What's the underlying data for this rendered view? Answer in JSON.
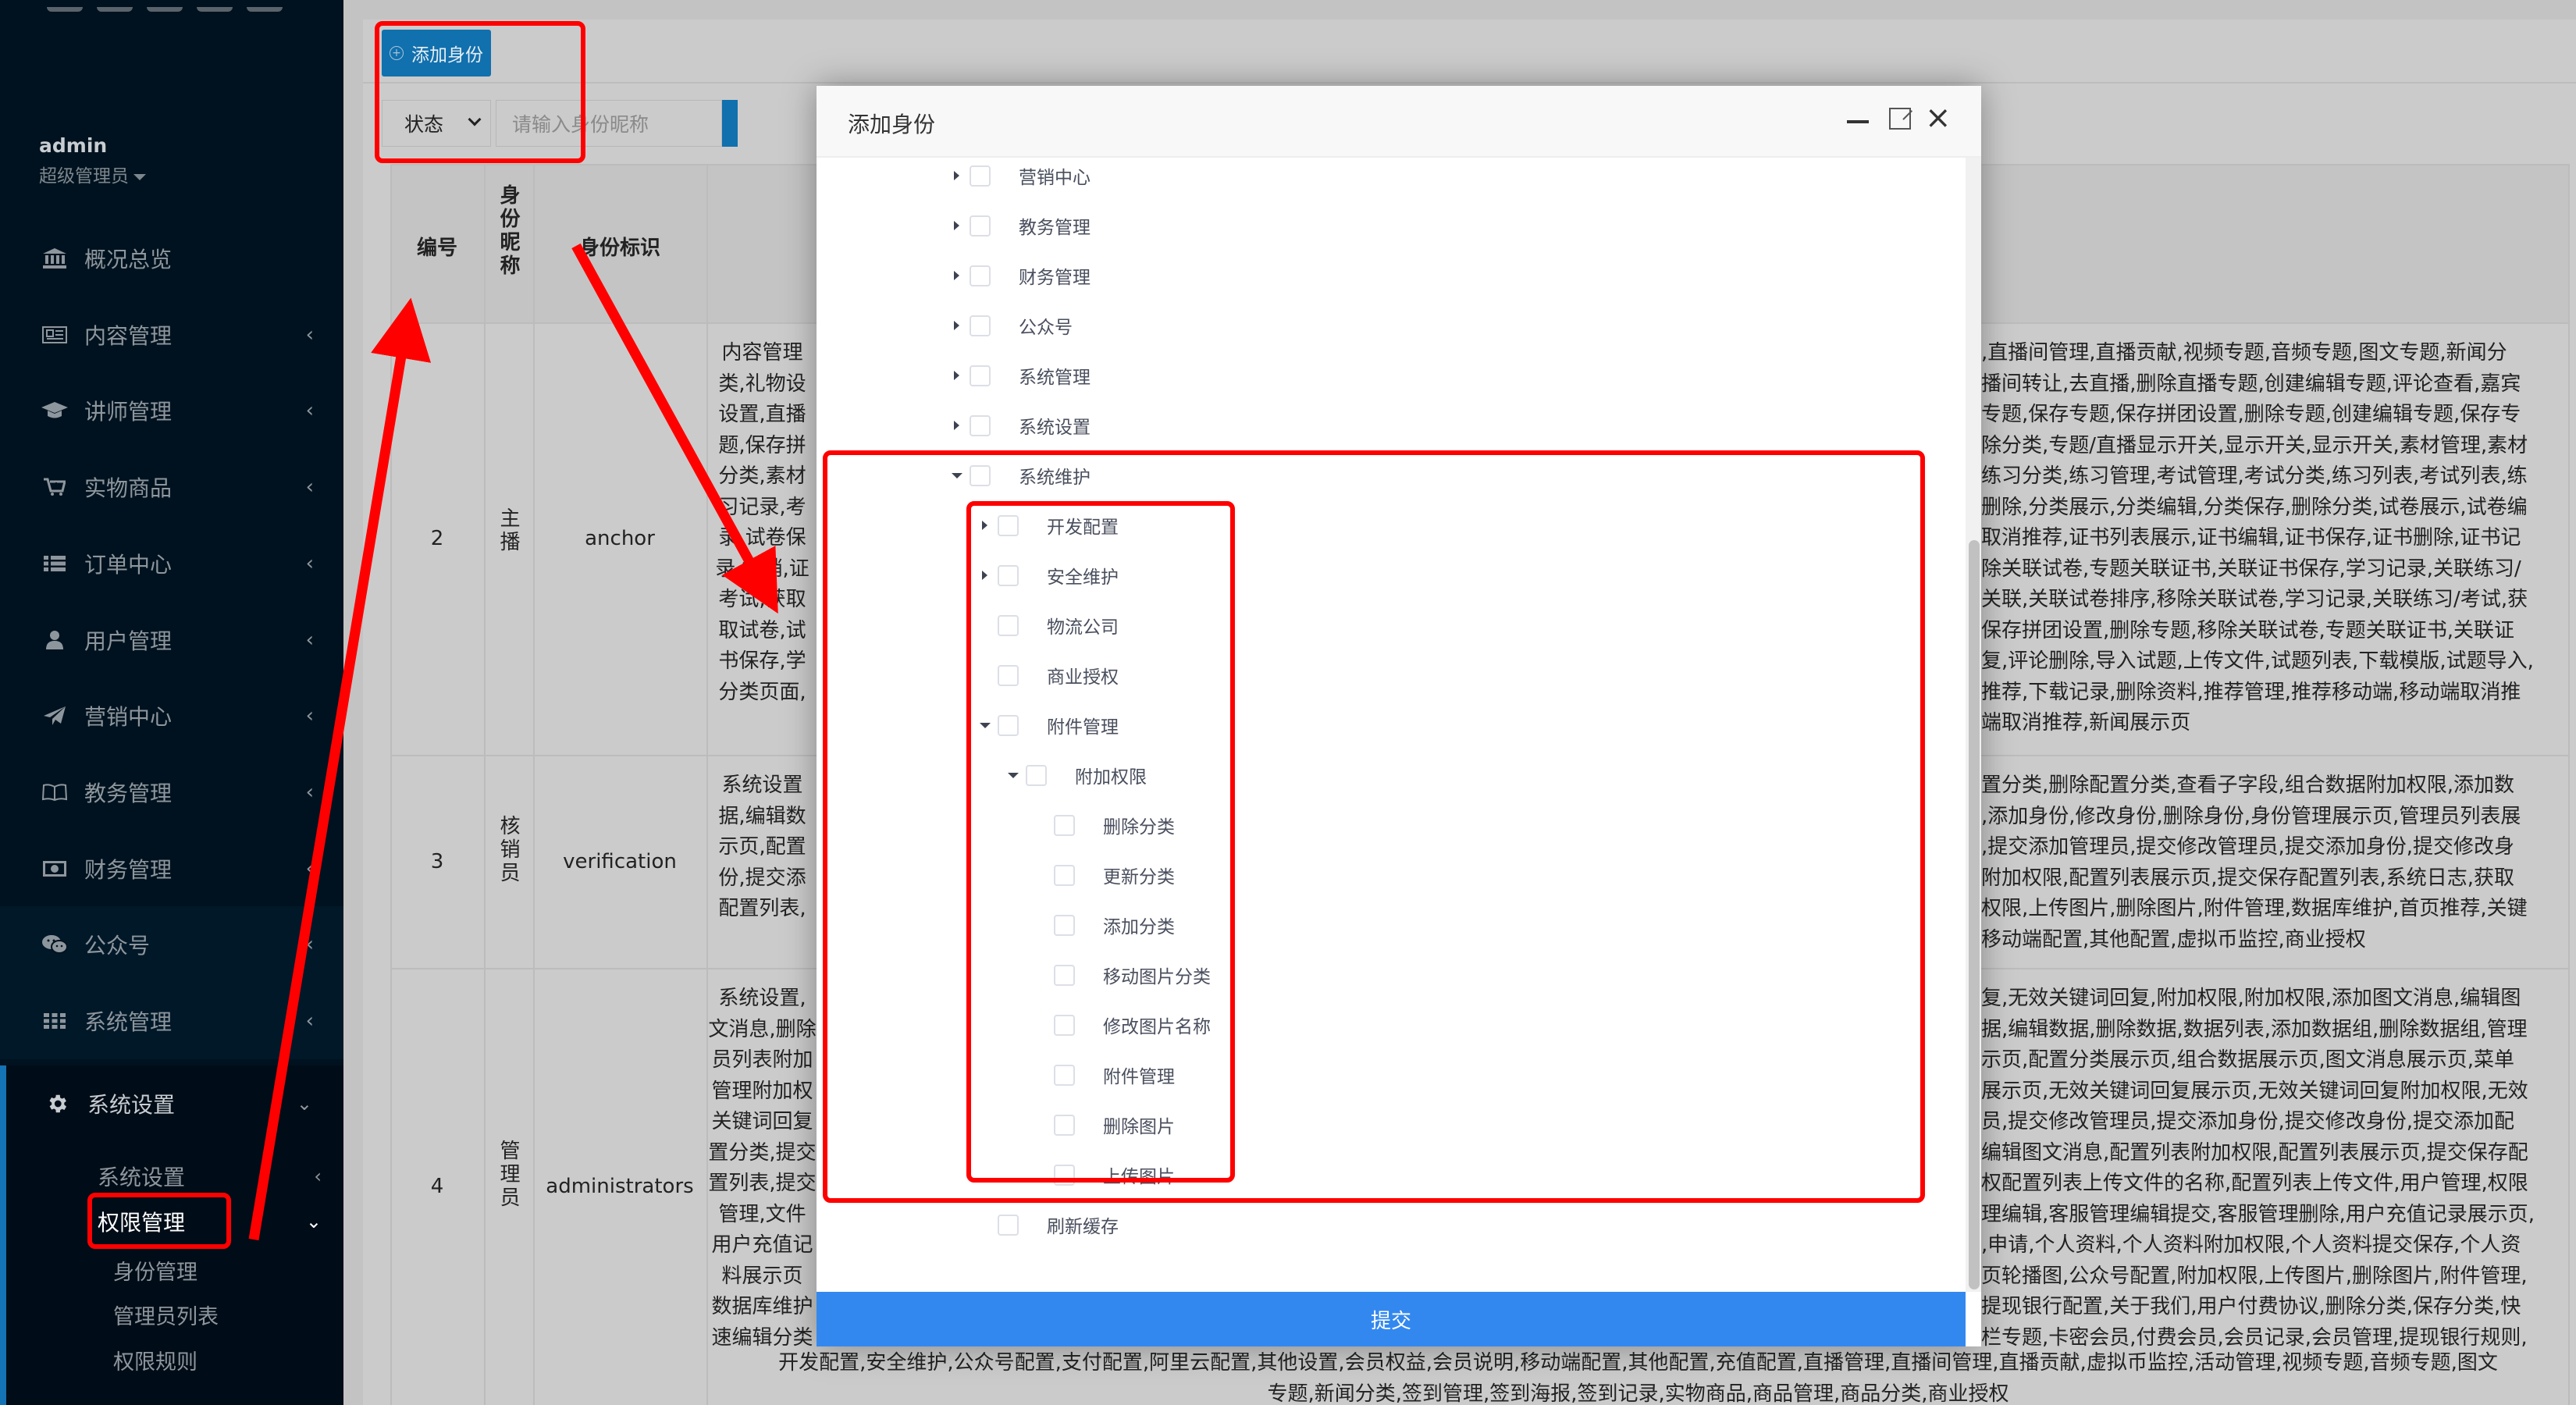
{
  "sidebar": {
    "user": {
      "name": "admin",
      "role": "超级管理员"
    },
    "menu": [
      {
        "label": "概况总览",
        "icon": "bank-icon",
        "chevron": ""
      },
      {
        "label": "内容管理",
        "icon": "newspaper-icon",
        "chevron": "‹"
      },
      {
        "label": "讲师管理",
        "icon": "graduation-cap-icon",
        "chevron": "‹"
      },
      {
        "label": "实物商品",
        "icon": "cart-plus-icon",
        "chevron": "‹"
      },
      {
        "label": "订单中心",
        "icon": "list-icon",
        "chevron": "‹"
      },
      {
        "label": "用户管理",
        "icon": "user-icon",
        "chevron": "‹"
      },
      {
        "label": "营销中心",
        "icon": "paper-plane-icon",
        "chevron": "‹"
      },
      {
        "label": "教务管理",
        "icon": "book-open-icon",
        "chevron": "‹"
      },
      {
        "label": "财务管理",
        "icon": "money-bill-icon",
        "chevron": "‹"
      },
      {
        "label": "公众号",
        "icon": "wechat-icon",
        "chevron": "‹"
      },
      {
        "label": "系统管理",
        "icon": "grid-icon",
        "chevron": "‹"
      }
    ],
    "active_group": {
      "label": "系统设置",
      "icon": "gear-icon",
      "chevron": "⌄"
    },
    "sub_items": [
      {
        "label": "系统设置",
        "chevron": "‹"
      },
      {
        "label": "权限管理",
        "chevron": "⌄"
      }
    ],
    "sub_sub_items": [
      "身份管理",
      "管理员列表",
      "权限规则"
    ]
  },
  "toolbar": {
    "add_button": "添加身份",
    "status_select": "状态",
    "search_placeholder": "请输入身份昵称"
  },
  "table": {
    "headers": [
      "编号",
      "身份昵称",
      "身份标识"
    ],
    "rows": [
      {
        "id": "2",
        "nickname": "主播",
        "identifier": "anchor",
        "rules_left": [
          "内容管理",
          "类,礼物设",
          "设置,直播",
          "题,保存拼",
          "分类,素材",
          "习记录,考",
          "录,试卷保",
          "录,撤销,证",
          "考试,获取",
          "取试卷,试",
          "书保存,学",
          "分类页面,"
        ],
        "rules_right": [
          ",直播间管理,直播贡献,视频专题,音频专题,图文专题,新闻分",
          "播间转让,去直播,删除直播专题,创建编辑专题,评论查看,嘉宾",
          "专题,保存专题,保存拼团设置,删除专题,创建编辑专题,保存专",
          "除分类,专题/直播显示开关,显示开关,显示开关,素材管理,素材",
          "练习分类,练习管理,考试管理,考试分类,练习列表,考试列表,练",
          "删除,分类展示,分类编辑,分类保存,删除分类,试卷展示,试卷编",
          "取消推荐,证书列表展示,证书编辑,证书保存,证书删除,证书记",
          "除关联试卷,专题关联证书,关联证书保存,学习记录,关联练习/",
          "关联,关联试卷排序,移除关联试卷,学习记录,关联练习/考试,获",
          "保存拼团设置,删除专题,移除关联试卷,专题关联证书,关联证",
          "复,评论删除,导入试题,上传文件,试题列表,下载模版,试题导入,",
          "推荐,下载记录,删除资料,推荐管理,推荐移动端,移动端取消推",
          "端取消推荐,新闻展示页"
        ]
      },
      {
        "id": "3",
        "nickname": "核销员",
        "identifier": "verification",
        "rules_left": [
          "系统设置",
          "据,编辑数",
          "示页,配置",
          "份,提交添",
          "配置列表,"
        ],
        "rules_right": [
          "置分类,删除配置分类,查看子字段,组合数据附加权限,添加数",
          ",添加身份,修改身份,删除身份,身份管理展示页,管理员列表展",
          ",提交添加管理员,提交修改管理员,提交添加身份,提交修改身",
          "附加权限,配置列表展示页,提交保存配置列表,系统日志,获取",
          "权限,上传图片,删除图片,附件管理,数据库维护,首页推荐,关键",
          "移动端配置,其他配置,虚拟币监控,商业授权"
        ]
      },
      {
        "id": "4",
        "nickname": "管理员",
        "identifier": "administrators",
        "rules_left": [
          "系统设置,",
          "文消息,删除",
          "员列表附加",
          "管理附加权",
          "关键词回复",
          "置分类,提交",
          "置列表,提交",
          "管理,文件",
          "用户充值记",
          "料展示页",
          "数据库维护",
          "速编辑分类"
        ],
        "rules_right": [
          "复,无效关键词回复,附加权限,附加权限,添加图文消息,编辑图",
          "据,编辑数据,删除数据,数据列表,添加数据组,删除数据组,管理",
          "示页,配置分类展示页,组合数据展示页,图文消息展示页,菜单",
          "展示页,无效关键词回复展示页,无效关键词回复附加权限,无效",
          "员,提交修改管理员,提交添加身份,提交修改身份,提交添加配",
          "编辑图文消息,配置列表附加权限,配置列表展示页,提交保存配",
          "权配置列表上传文件的名称,配置列表上传文件,用户管理,权限",
          "理编辑,客服管理编辑提交,客服管理删除,用户充值记录展示页,",
          ",申请,个人资料,个人资料附加权限,个人资料提交保存,个人资",
          "页轮播图,公众号配置,附加权限,上传图片,删除图片,附件管理,",
          "提现银行配置,关于我们,用户付费协议,删除分类,保存分类,快",
          "栏专题,卡密会员,付费会员,会员记录,会员管理,提现银行规则,"
        ],
        "rules_full_lines": [
          "开发配置,安全维护,公众号配置,支付配置,阿里云配置,其他设置,会员权益,会员说明,移动端配置,其他配置,充值配置,直播管理,直播间管理,直播贡献,虚拟币监控,活动管理,视频专题,音频专题,图文",
          "专题,新闻分类,签到管理,签到海报,签到记录,实物商品,商品管理,商品分类,商业授权"
        ]
      }
    ]
  },
  "modal": {
    "title": "添加身份",
    "submit_label": "提交",
    "tree": [
      {
        "label": "营销中心",
        "level": 0,
        "expand": "right"
      },
      {
        "label": "教务管理",
        "level": 0,
        "expand": "right"
      },
      {
        "label": "财务管理",
        "level": 0,
        "expand": "right"
      },
      {
        "label": "公众号",
        "level": 0,
        "expand": "right"
      },
      {
        "label": "系统管理",
        "level": 0,
        "expand": "right"
      },
      {
        "label": "系统设置",
        "level": 0,
        "expand": "right"
      },
      {
        "label": "系统维护",
        "level": 0,
        "expand": "down"
      },
      {
        "label": "开发配置",
        "level": 1,
        "expand": "right"
      },
      {
        "label": "安全维护",
        "level": 1,
        "expand": "right"
      },
      {
        "label": "物流公司",
        "level": 1,
        "expand": "none"
      },
      {
        "label": "商业授权",
        "level": 1,
        "expand": "none"
      },
      {
        "label": "附件管理",
        "level": 1,
        "expand": "down"
      },
      {
        "label": "附加权限",
        "level": 2,
        "expand": "down"
      },
      {
        "label": "删除分类",
        "level": 3,
        "expand": "none"
      },
      {
        "label": "更新分类",
        "level": 3,
        "expand": "none"
      },
      {
        "label": "添加分类",
        "level": 3,
        "expand": "none"
      },
      {
        "label": "移动图片分类",
        "level": 3,
        "expand": "none"
      },
      {
        "label": "修改图片名称",
        "level": 3,
        "expand": "none"
      },
      {
        "label": "附件管理",
        "level": 3,
        "expand": "none"
      },
      {
        "label": "删除图片",
        "level": 3,
        "expand": "none"
      },
      {
        "label": "上传图片",
        "level": 3,
        "expand": "none"
      },
      {
        "label": "刷新缓存",
        "level": 1,
        "expand": "none"
      }
    ]
  },
  "colors": {
    "sidebar_bg": "#00121f",
    "primary": "#1170ae",
    "submit": "#3388f0",
    "annotation": "#ff0000"
  }
}
